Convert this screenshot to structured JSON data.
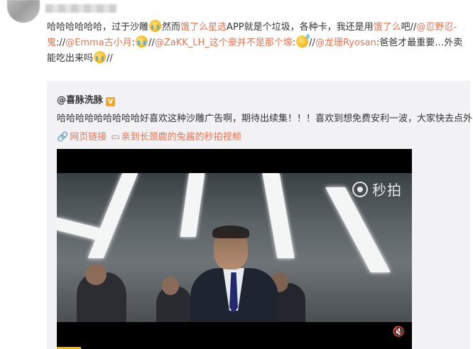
{
  "post": {
    "text_a": "哈哈哈哈哈哈，过于沙雕",
    "text_b": "然而",
    "brand_red": "饿了么星选",
    "text_c": "APP就是个垃圾，各种卡，我还是用",
    "brand_red_2": "饿了么",
    "text_d": "吧//",
    "mention_1": "@忍野忍-鬼",
    "sep_1": "://",
    "mention_2": "@Emma古小月",
    "sep_2": ":",
    "sep_3": "//",
    "mention_3": "@ZaKK_LH_这个豪并不是那个壕",
    "sep_4": ":",
    "sep_5": "//",
    "mention_4": "@龙珊Ryosan",
    "text_e": ":爸爸才最重要…外卖能吃出来吗",
    "text_f": "//"
  },
  "repost": {
    "author": "@喜脉洗脉",
    "verified_label": "V",
    "text": "哈哈哈哈哈哈哈哈哈好喜欢这种沙雕广告啊，期待出续集！！！喜欢到想免费安利一波，大家快去点外卖",
    "link_1": "网页链接",
    "link_2": "亲到长颈鹿的兔酱的秒拍视频"
  },
  "video": {
    "watermark": "秒拍",
    "progress_fraction": 0.068
  },
  "icons": {
    "link": "link-icon",
    "video": "video-icon",
    "mute": "mute-icon"
  },
  "colors": {
    "link": "#eb7350",
    "repost_bg": "#f2f2f5",
    "progress": "#f4b400"
  }
}
